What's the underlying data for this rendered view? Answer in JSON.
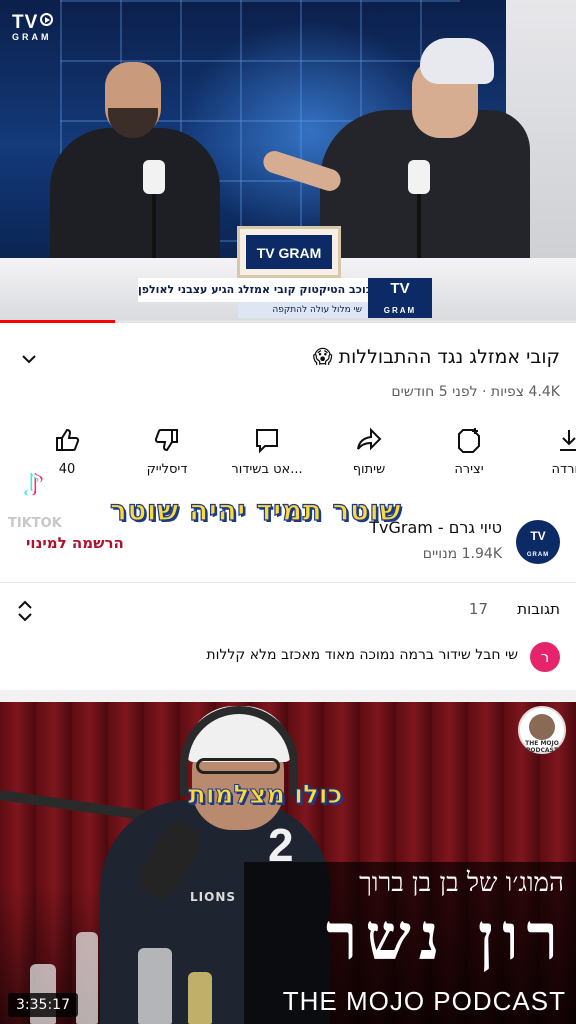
{
  "video_top": {
    "logo_tv": "TV",
    "logo_gram": "GRAM",
    "desk_sign": "TV GRAM",
    "lower_third_main": "כוכב הטיקטוק קובי אמזלג הגיע עצבני לאולפן",
    "lower_third_sub": "שי מלול עולה להתקפה",
    "lower_third_logo_tv": "TV",
    "lower_third_logo_gram": "GRAM",
    "progress": 0.2
  },
  "video_info": {
    "title": "קובי אמזלג נגד ההתבוללות 😱",
    "meta": "4.4K צפיות · לפני 5 חודשים"
  },
  "actions": [
    {
      "label": "40",
      "icon": "thumbs-up-icon"
    },
    {
      "label": "דיסלייק",
      "icon": "thumbs-down-icon"
    },
    {
      "label": "אט בשידור...",
      "icon": "live-chat-icon"
    },
    {
      "label": "שיתוף",
      "icon": "share-icon"
    },
    {
      "label": "יצירה",
      "icon": "remix-icon"
    },
    {
      "label": "הורדה",
      "icon": "download-icon"
    }
  ],
  "channel": {
    "name": "טיוי גרם - TvGram",
    "subscribers": "1.94K מנויים",
    "avatar_tv": "TV",
    "avatar_gram": "GRAM"
  },
  "tiktok": {
    "handle": "TIKTOK",
    "register_label": "הרשמה למינוי"
  },
  "captions": {
    "top": "שוטר תמיד יהיה שוטר",
    "bottom": "כולו מצלמות"
  },
  "comments": {
    "title": "תגובות",
    "count": "17",
    "first_avatar": "ר",
    "first_text": "שי חבל שידור ברמה נמוכה מאוד מאכזב מלא קללות"
  },
  "video_bottom": {
    "jersey_number": "2",
    "jersey_team": "LIONS",
    "subtitle": "המוג׳ו של בן בן ברוך",
    "guest_name": "רון נשר",
    "podcast_name": "THE MOJO PODCAST",
    "badge_text": "THE MOJO PODCAST",
    "timestamp": "3:35:17"
  },
  "colors": {
    "caption_yellow": "#ffd83a",
    "caption_outline": "#1b3b8a",
    "youtube_red": "#ff0000",
    "comment_avatar": "#e6246b",
    "tvgram_navy": "#0c2a66"
  }
}
